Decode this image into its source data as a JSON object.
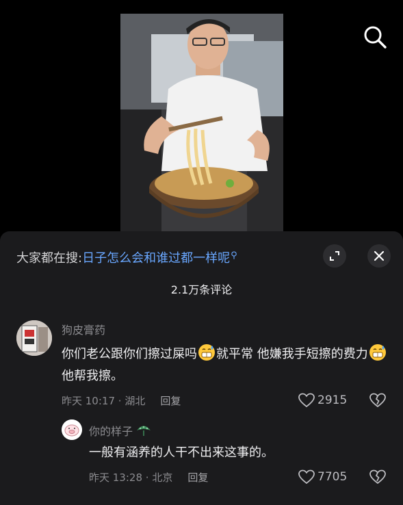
{
  "search_suggestion": {
    "prefix": "大家都在搜:",
    "query": "日子怎么会和谁过都一样呢"
  },
  "comment_count": "2.1万条评论",
  "comments": [
    {
      "username": "狗皮膏药",
      "text_part1": "你们老公跟你们擦过屎吗",
      "text_part2": "就平常 他嫌我手短擦的费力",
      "text_part3": "他帮我擦。",
      "time": "昨天 10:17",
      "location": "湖北",
      "reply_label": "回复",
      "likes": "2915"
    },
    {
      "username": "你的样子",
      "text": "一般有涵养的人干不出来这事的。",
      "time": "昨天 13:28",
      "location": "北京",
      "reply_label": "回复",
      "likes": "7705"
    }
  ],
  "colors": {
    "sheet_bg": "#1b1b1d",
    "link_blue": "#69a7ff",
    "muted_text": "#8c8c90"
  },
  "icons": {
    "search": "search-icon",
    "expand": "expand-icon",
    "close": "close-icon",
    "like": "heart-icon",
    "dislike": "broken-heart-icon",
    "emoji": "sweat-grin-emoji",
    "search_mag": "magnifier-icon",
    "reply_badge": "peacock-badge-icon"
  }
}
